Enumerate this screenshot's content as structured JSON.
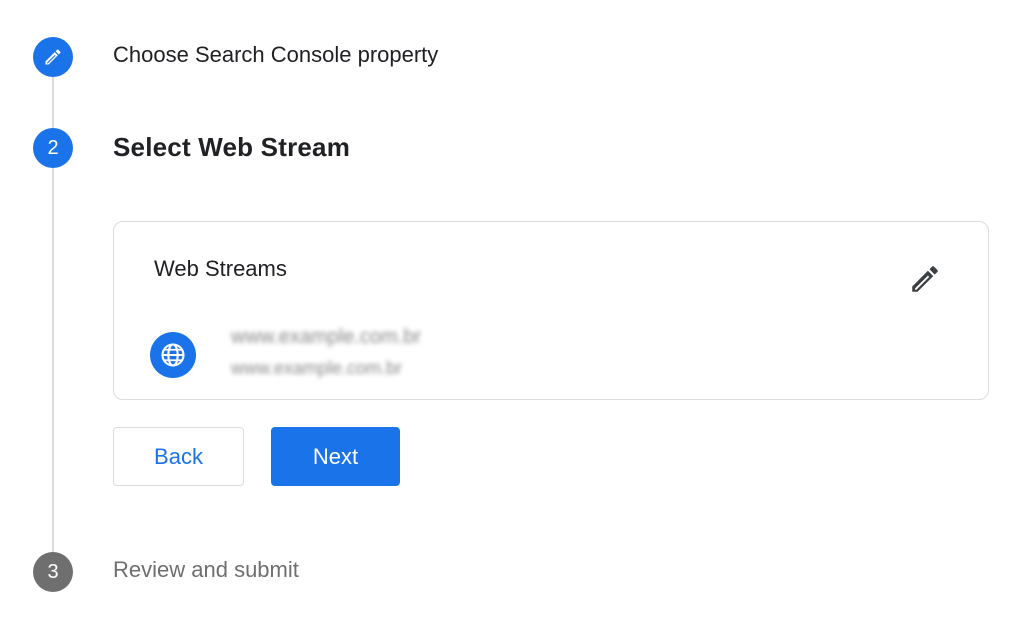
{
  "colors": {
    "accent": "#1a73e8",
    "inactive_step": "#6f6f6f",
    "border": "#dadce0",
    "text": "#202124"
  },
  "steps": [
    {
      "number": "",
      "icon": "pencil-icon",
      "state": "completed",
      "label": "Choose Search Console property"
    },
    {
      "number": "2",
      "state": "active",
      "label": "Select Web Stream"
    },
    {
      "number": "3",
      "state": "upcoming",
      "label": "Review and submit"
    }
  ],
  "card": {
    "title": "Web Streams",
    "edit_icon": "pencil-icon",
    "stream_icon": "globe-icon",
    "stream_name": "www.example.com.br",
    "stream_id": "www.example.com.br"
  },
  "buttons": {
    "back": "Back",
    "next": "Next"
  }
}
